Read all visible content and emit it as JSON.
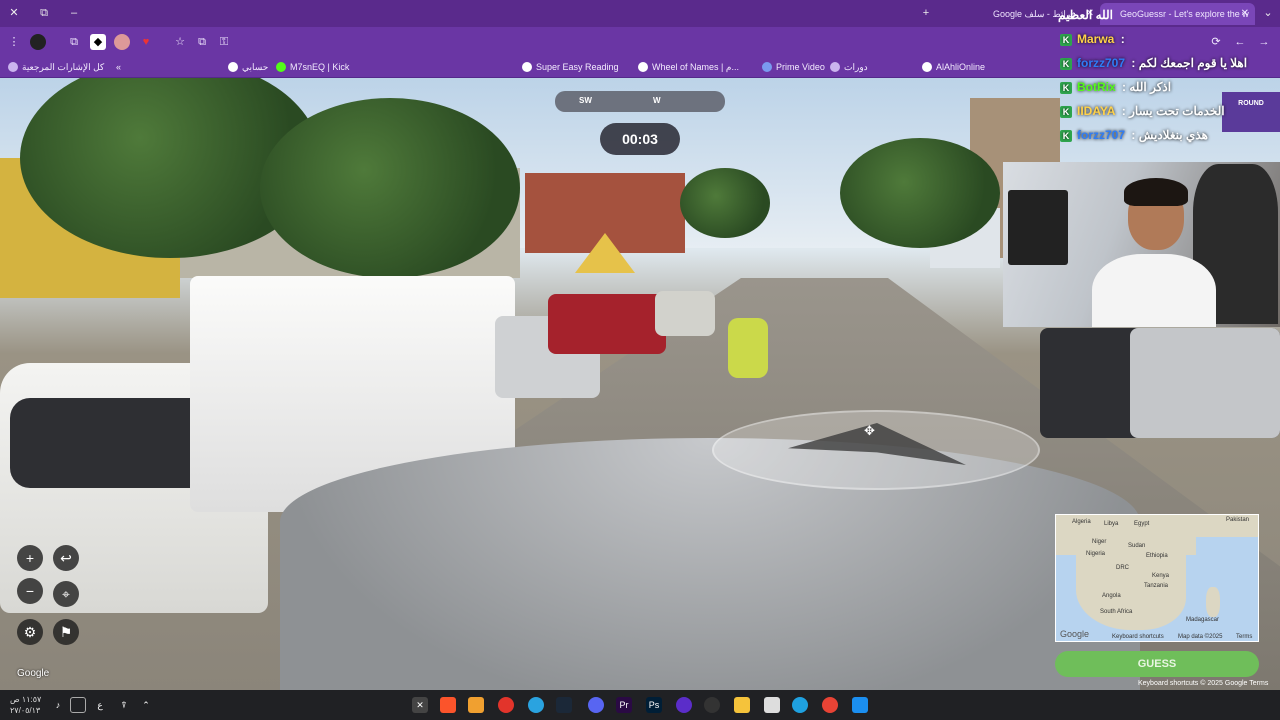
{
  "browser": {
    "tabs": [
      {
        "label": "GeoGuessr - Let's explore the w",
        "active": true
      },
      {
        "label": "Google خرائط - سلف",
        "active": false
      }
    ],
    "overlay_title": "الله العظيم",
    "window_controls": [
      "✕",
      "⧉",
      "–"
    ],
    "new_tab": "+",
    "addr_icons": [
      "⋮",
      "☆",
      "⟳",
      "←",
      "→"
    ]
  },
  "bookmarks": [
    {
      "label": "كل الإشارات المرجعية",
      "color": "#f4ecff"
    },
    {
      "label": "حسابي",
      "color": "#ffffff"
    },
    {
      "label": "M7snEQ | Kick",
      "color": "#53fc18"
    },
    {
      "label": "Super Easy Reading",
      "color": "#ffffff"
    },
    {
      "label": "Wheel of Names | م...",
      "color": "#ffffff"
    },
    {
      "label": "Prime Video",
      "color": "#ffffff"
    },
    {
      "label": "دورات",
      "color": "#ffffff"
    },
    {
      "label": "AlAhliOnline",
      "color": "#ffffff"
    }
  ],
  "game": {
    "compass": {
      "left": "SW",
      "right": "W"
    },
    "timer": "00:03",
    "round_label": "ROUND",
    "guess_label": "GUESS",
    "google_watermark": "Google",
    "keyboard_footer": "Keyboard shortcuts  © 2025 Google  Terms",
    "controls": {
      "zoom_in": "+",
      "zoom_out": "−",
      "back": "↩",
      "pin": "⌖",
      "settings": "⚙",
      "flag": "⚑"
    }
  },
  "minimap": {
    "labels": [
      "Algeria",
      "Libya",
      "Egypt",
      "Pakistan",
      "Niger",
      "Sudan",
      "Nigeria",
      "Ethiopia",
      "DRC",
      "Kenya",
      "Tanzania",
      "Angola",
      "Madagascar",
      "South Africa",
      "Google",
      "Keyboard shortcuts",
      "Map data ©2025",
      "Terms"
    ]
  },
  "chat": [
    {
      "user": "Marwa",
      "message": "",
      "user_color": "#ffd24a"
    },
    {
      "user": "forzz707",
      "message": "اهلا يا قوم اجمعك لكم",
      "user_color": "#2e7cf6"
    },
    {
      "user": "BotRix",
      "message": "اذكر الله",
      "user_color": "#53fc18"
    },
    {
      "user": "IIDAYA",
      "message": "الخدمات تحت يسار",
      "user_color": "#ffd24a"
    },
    {
      "user": "forzz707",
      "message": "هذي بنغلاديش",
      "user_color": "#2e7cf6"
    }
  ],
  "taskbar": {
    "clock": "١١:٥٧ ص",
    "date": "٢٧/٠٥/١٣",
    "lang": "ع"
  }
}
